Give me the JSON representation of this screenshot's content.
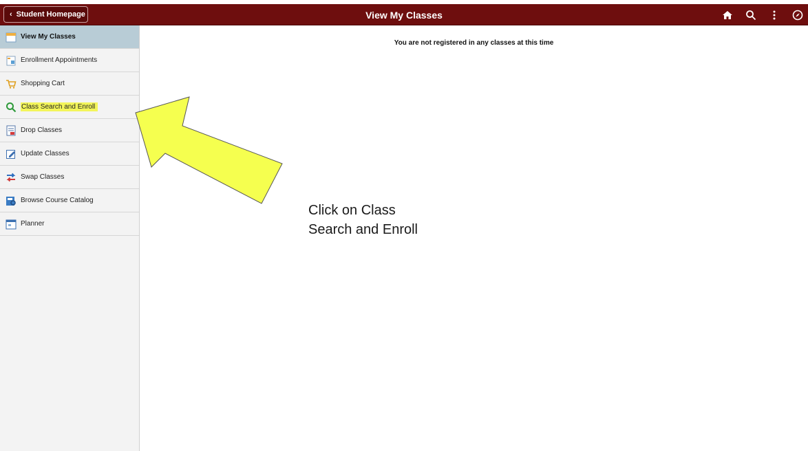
{
  "header": {
    "back_label": "Student Homepage",
    "title": "View My Classes",
    "icons": [
      "home-icon",
      "search-icon",
      "more-icon",
      "compass-icon"
    ],
    "bar_color": "#6e0e0e"
  },
  "sidebar": {
    "items": [
      {
        "label": "View My Classes",
        "icon": "calendar-icon",
        "active": true
      },
      {
        "label": "Enrollment Appointments",
        "icon": "appointment-icon"
      },
      {
        "label": "Shopping Cart",
        "icon": "cart-icon"
      },
      {
        "label": "Class Search and Enroll",
        "icon": "search-icon",
        "highlighted": true
      },
      {
        "label": "Drop Classes",
        "icon": "drop-icon"
      },
      {
        "label": "Update Classes",
        "icon": "edit-icon"
      },
      {
        "label": "Swap Classes",
        "icon": "swap-icon"
      },
      {
        "label": "Browse Course Catalog",
        "icon": "catalog-icon"
      },
      {
        "label": "Planner",
        "icon": "planner-icon"
      }
    ],
    "active_color": "#b8ccd6",
    "highlight_color": "#f3f55a"
  },
  "main": {
    "message": "You are not registered in any classes at this time"
  },
  "annotation": {
    "text_line1": "Click on Class",
    "text_line2": "Search and Enroll",
    "arrow_color": "#f5ff4f"
  }
}
